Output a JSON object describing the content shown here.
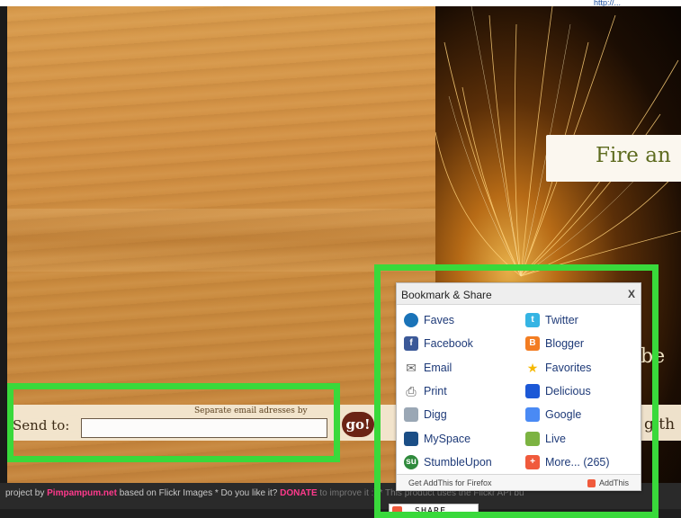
{
  "header": {
    "link_text": "http://..."
  },
  "photo": {
    "title": "Fire an",
    "side_text": "be"
  },
  "send": {
    "label": "Send to:",
    "note": "Separate email adresses by",
    "value": "",
    "go_label": "go!",
    "right_text": "g th"
  },
  "footer": {
    "prefix": "project by ",
    "brand": "Pimpampum.net",
    "middle": " based on Flickr Images * Do you like it? ",
    "donate": "DONATE",
    "tail": " to improve it :) * This product uses the Flickr API bu"
  },
  "popup": {
    "title": "Bookmark & Share",
    "close_label": "X",
    "items_left": [
      {
        "label": "Faves",
        "icon": "faves-icon",
        "color": "#1a73b8"
      },
      {
        "label": "Facebook",
        "icon": "facebook-icon",
        "color": "#3b5998"
      },
      {
        "label": "Email",
        "icon": "email-icon",
        "color": "#666666"
      },
      {
        "label": "Print",
        "icon": "print-icon",
        "color": "#555555"
      },
      {
        "label": "Digg",
        "icon": "digg-icon",
        "color": "#9aa7b5"
      },
      {
        "label": "MySpace",
        "icon": "myspace-icon",
        "color": "#1b4e86"
      },
      {
        "label": "StumbleUpon",
        "icon": "stumbleupon-icon",
        "color": "#2f8a3c"
      }
    ],
    "items_right": [
      {
        "label": "Twitter",
        "icon": "twitter-icon",
        "color": "#35b4e3"
      },
      {
        "label": "Blogger",
        "icon": "blogger-icon",
        "color": "#f37d22"
      },
      {
        "label": "Favorites",
        "icon": "favorites-star-icon",
        "color": "#f5b800"
      },
      {
        "label": "Delicious",
        "icon": "delicious-icon",
        "color": "#1c58d6"
      },
      {
        "label": "Google",
        "icon": "google-icon",
        "color": "#4a8af4"
      },
      {
        "label": "Live",
        "icon": "live-icon",
        "color": "#7cb342"
      },
      {
        "label": "More... (265)",
        "icon": "more-icon",
        "color": "#f05a3c"
      }
    ],
    "footer_left": "Get AddThis for Firefox",
    "footer_right": "AddThis"
  },
  "share_button": {
    "label": "SHARE"
  },
  "colors": {
    "highlight": "#39d93b",
    "brand_pink": "#ff3a8c",
    "go_button": "#6b2415"
  }
}
